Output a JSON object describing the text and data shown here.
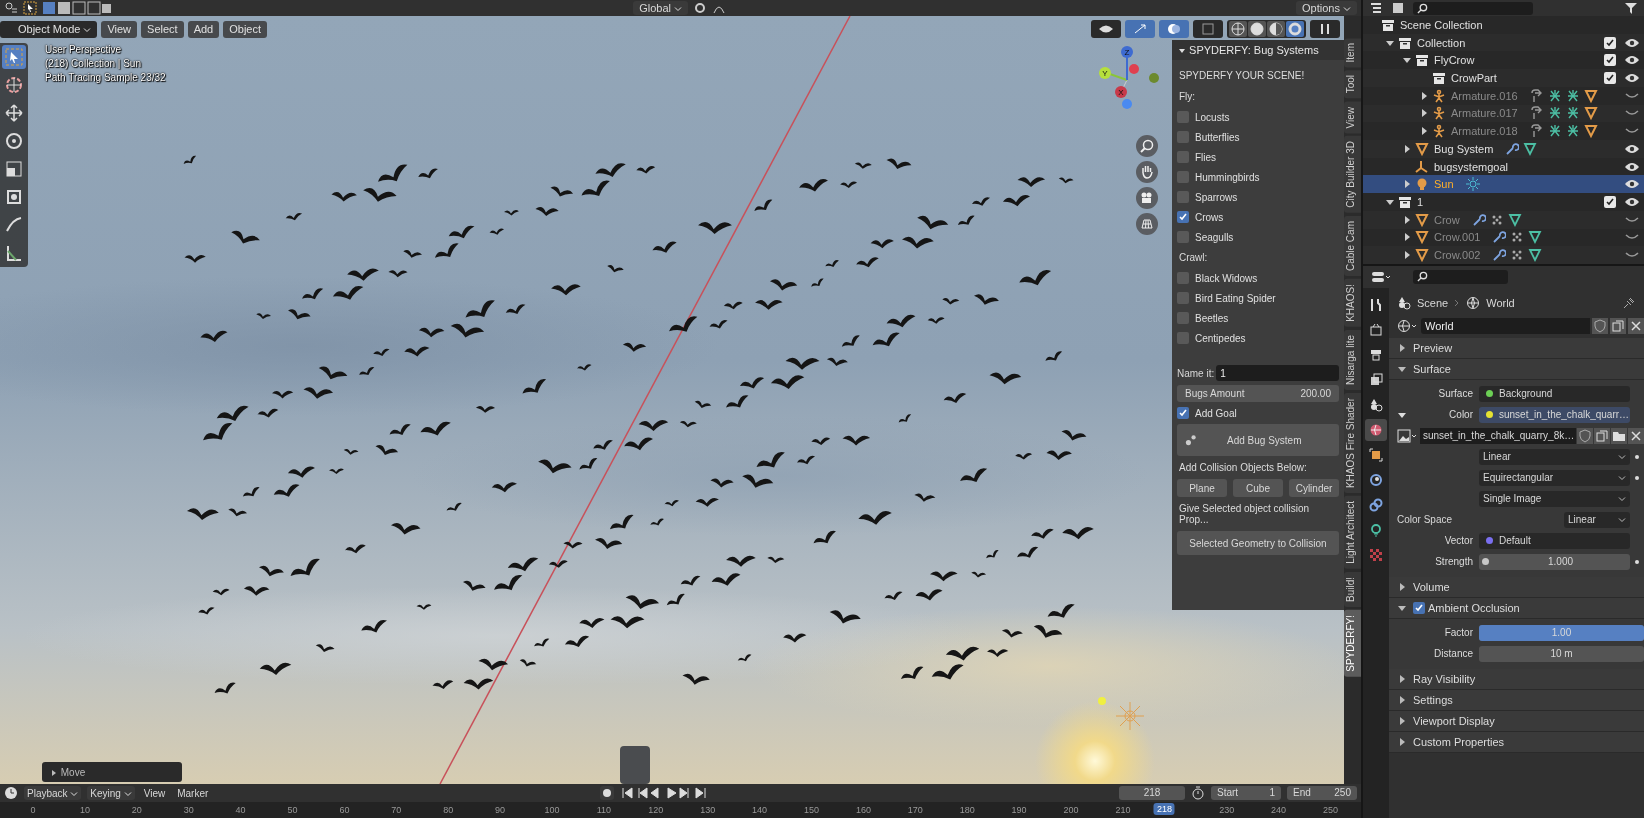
{
  "top_bar": {
    "orientation": "Global",
    "options": "Options"
  },
  "viewport": {
    "mode": "Object Mode",
    "menus": [
      "View",
      "Select",
      "Add",
      "Object"
    ],
    "shading": [
      {
        "kind": "wireframe",
        "selected": false
      },
      {
        "kind": "solid",
        "selected": false
      },
      {
        "kind": "material",
        "selected": false
      },
      {
        "kind": "rendered",
        "selected": true
      }
    ],
    "info": [
      "User Perspective",
      "(218) Collection | Sun",
      "Path Tracing Sample 23/32"
    ],
    "tools": [
      {
        "kind": "select",
        "selected": true
      },
      {
        "kind": "cursor",
        "selected": false
      },
      {
        "kind": "move",
        "selected": false
      },
      {
        "kind": "rotate",
        "selected": false
      },
      {
        "kind": "scale",
        "selected": false
      },
      {
        "kind": "transform",
        "selected": false
      },
      {
        "kind": "annotate",
        "selected": false
      },
      {
        "kind": "measure",
        "selected": false
      }
    ],
    "gizmo_axes": [
      "Z",
      "Y",
      "X"
    ],
    "last_operator": "Move"
  },
  "addon_panel": {
    "title": "SPYDERFY: Bug Systems",
    "heading": "SPYDERFY YOUR SCENE!",
    "fly_label": "Fly:",
    "fly": [
      {
        "label": "Locusts",
        "checked": false
      },
      {
        "label": "Butterflies",
        "checked": false
      },
      {
        "label": "Flies",
        "checked": false
      },
      {
        "label": "Hummingbirds",
        "checked": false
      },
      {
        "label": "Sparrows",
        "checked": false
      },
      {
        "label": "Crows",
        "checked": true
      },
      {
        "label": "Seagulls",
        "checked": false
      }
    ],
    "crawl_label": "Crawl:",
    "crawl": [
      {
        "label": "Black Widows",
        "checked": false
      },
      {
        "label": "Bird Eating Spider",
        "checked": false
      },
      {
        "label": "Beetles",
        "checked": false
      },
      {
        "label": "Centipedes",
        "checked": false
      }
    ],
    "name_label": "Name it:",
    "name_value": "1",
    "amount": {
      "label": "Bugs Amount",
      "value": "200.00"
    },
    "add_goal": {
      "label": "Add Goal",
      "checked": true
    },
    "add_button": "Add Bug System",
    "collision_label": "Add Collision Objects Below:",
    "collision_buttons": [
      "Plane",
      "Cube",
      "Cylinder"
    ],
    "collision_note": "Give Selected object collision Prop...",
    "collision_button": "Selected Geometry to Collision"
  },
  "sidebar_tabs": [
    {
      "label": "Item",
      "selected": false
    },
    {
      "label": "Tool",
      "selected": false
    },
    {
      "label": "View",
      "selected": false
    },
    {
      "label": "City Builder 3D",
      "selected": false
    },
    {
      "label": "Cable Cam",
      "selected": false
    },
    {
      "label": "KHAOS!",
      "selected": false
    },
    {
      "label": "Nisarga lite",
      "selected": false
    },
    {
      "label": "KHAOS Fire Shader",
      "selected": false
    },
    {
      "label": "Light Architect",
      "selected": false
    },
    {
      "label": "Build!",
      "selected": false
    },
    {
      "label": "SPYDERFY!",
      "selected": true
    }
  ],
  "outliner": {
    "items": [
      {
        "name": "Scene Collection",
        "kind": "collection",
        "selected": false,
        "children": [
          {
            "name": "Collection",
            "kind": "collection",
            "expanded": true,
            "checked": true,
            "visible": true,
            "selected": false,
            "children": [
              {
                "name": "FlyCrow",
                "kind": "collection",
                "expanded": true,
                "checked": true,
                "visible": true,
                "selected": false,
                "children": [
                  {
                    "name": "CrowPart",
                    "kind": "collection",
                    "checked": true,
                    "visible": true,
                    "selected": false
                  },
                  {
                    "name": "Armature.016",
                    "kind": "armature",
                    "expanded": false,
                    "visible": false,
                    "selected": false,
                    "extras": [
                      {
                        "kind": "constraint"
                      },
                      {
                        "kind": "armature"
                      },
                      {
                        "kind": "armature"
                      },
                      {
                        "kind": "mesh"
                      }
                    ]
                  },
                  {
                    "name": "Armature.017",
                    "kind": "armature",
                    "expanded": false,
                    "visible": false,
                    "selected": false,
                    "extras": [
                      {
                        "kind": "constraint"
                      },
                      {
                        "kind": "armature"
                      },
                      {
                        "kind": "armature"
                      },
                      {
                        "kind": "mesh"
                      }
                    ]
                  },
                  {
                    "name": "Armature.018",
                    "kind": "armature",
                    "expanded": false,
                    "visible": false,
                    "selected": false,
                    "extras": [
                      {
                        "kind": "constraint"
                      },
                      {
                        "kind": "armature"
                      },
                      {
                        "kind": "armature"
                      },
                      {
                        "kind": "mesh"
                      }
                    ]
                  }
                ]
              },
              {
                "name": "Bug System",
                "kind": "mesh",
                "expanded": false,
                "visible": true,
                "selected": false,
                "extras": [
                  {
                    "kind": "modifier"
                  },
                  {
                    "kind": "mesh_data"
                  }
                ]
              },
              {
                "name": "bugsystemgoal",
                "kind": "empty",
                "visible": true,
                "selected": false
              },
              {
                "name": "Sun",
                "kind": "light",
                "expanded": false,
                "visible": true,
                "selected": true,
                "extras": [
                  {
                    "kind": "light_data"
                  }
                ]
              }
            ]
          },
          {
            "name": "1",
            "kind": "collection",
            "expanded": true,
            "checked": true,
            "visible": true,
            "selected": false,
            "children": [
              {
                "name": "Crow",
                "kind": "mesh",
                "expanded": false,
                "visible": false,
                "selected": false,
                "extras": [
                  {
                    "kind": "modifier"
                  },
                  {
                    "kind": "particles"
                  },
                  {
                    "kind": "mesh_data"
                  }
                ]
              },
              {
                "name": "Crow.001",
                "kind": "mesh",
                "expanded": false,
                "visible": false,
                "selected": false,
                "extras": [
                  {
                    "kind": "modifier"
                  },
                  {
                    "kind": "particles"
                  },
                  {
                    "kind": "mesh_data"
                  }
                ]
              },
              {
                "name": "Crow.002",
                "kind": "mesh",
                "expanded": false,
                "visible": false,
                "selected": false,
                "extras": [
                  {
                    "kind": "modifier"
                  },
                  {
                    "kind": "particles"
                  },
                  {
                    "kind": "mesh_data"
                  }
                ]
              }
            ]
          }
        ]
      }
    ]
  },
  "properties": {
    "breadcrumb": [
      "Scene",
      "World"
    ],
    "world_name": "World",
    "tabs": [
      {
        "kind": "tool",
        "selected": false
      },
      {
        "kind": "render",
        "selected": false
      },
      {
        "kind": "output",
        "selected": false
      },
      {
        "kind": "view_layer",
        "selected": false
      },
      {
        "kind": "scene",
        "selected": false
      },
      {
        "kind": "world",
        "selected": true
      },
      {
        "kind": "object",
        "selected": false
      },
      {
        "kind": "modifier",
        "selected": false
      },
      {
        "kind": "physics",
        "selected": false
      },
      {
        "kind": "light",
        "selected": false
      },
      {
        "kind": "texture",
        "selected": false
      }
    ],
    "sections": [
      {
        "title": "Preview",
        "expanded": false
      },
      {
        "title": "Surface",
        "expanded": true,
        "rows": [
          {
            "kind": "socket",
            "label": "Surface",
            "value": "Background",
            "color": "#6ccf55"
          },
          {
            "kind": "socket",
            "label": "Color",
            "value": "sunset_in_the_chalk_quarr…",
            "color": "#e5e232",
            "expanded": true
          },
          {
            "kind": "image",
            "value": "sunset_in_the_chalk_quarry_8k…"
          },
          {
            "kind": "dropdown",
            "value": "Linear",
            "animatable": true
          },
          {
            "kind": "dropdown",
            "value": "Equirectangular",
            "animatable": true
          },
          {
            "kind": "dropdown",
            "value": "Single Image",
            "animatable": false
          },
          {
            "kind": "labeled_dropdown",
            "label": "Color Space",
            "value": "Linear"
          },
          {
            "kind": "socket",
            "label": "Vector",
            "value": "Default",
            "color": "#7a6ff0"
          },
          {
            "kind": "socket_number",
            "label": "Strength",
            "value": "1.000",
            "color": "#c7c7c7",
            "animatable": true
          }
        ]
      },
      {
        "title": "Volume",
        "expanded": false
      },
      {
        "title": "Ambient Occlusion",
        "expanded": true,
        "checked": true,
        "rows": [
          {
            "kind": "slider",
            "label": "Factor",
            "value": "1.00",
            "level": 1
          },
          {
            "kind": "number",
            "label": "Distance",
            "value": "10 m"
          }
        ]
      },
      {
        "title": "Ray Visibility",
        "expanded": false
      },
      {
        "title": "Settings",
        "expanded": false
      },
      {
        "title": "Viewport Display",
        "expanded": false
      },
      {
        "title": "Custom Properties",
        "expanded": false
      }
    ]
  },
  "timeline": {
    "menus": [
      "Playback",
      "Keying",
      "View",
      "Marker"
    ],
    "frame": "218",
    "start_label": "Start",
    "start": "1",
    "end_label": "End",
    "end": "250",
    "ruler": [
      "0",
      "10",
      "20",
      "30",
      "40",
      "50",
      "60",
      "70",
      "80",
      "90",
      "100",
      "110",
      "120",
      "130",
      "140",
      "150",
      "160",
      "170",
      "180",
      "190",
      "200",
      "210",
      "230",
      "240",
      "250"
    ],
    "current_frame": "218"
  }
}
